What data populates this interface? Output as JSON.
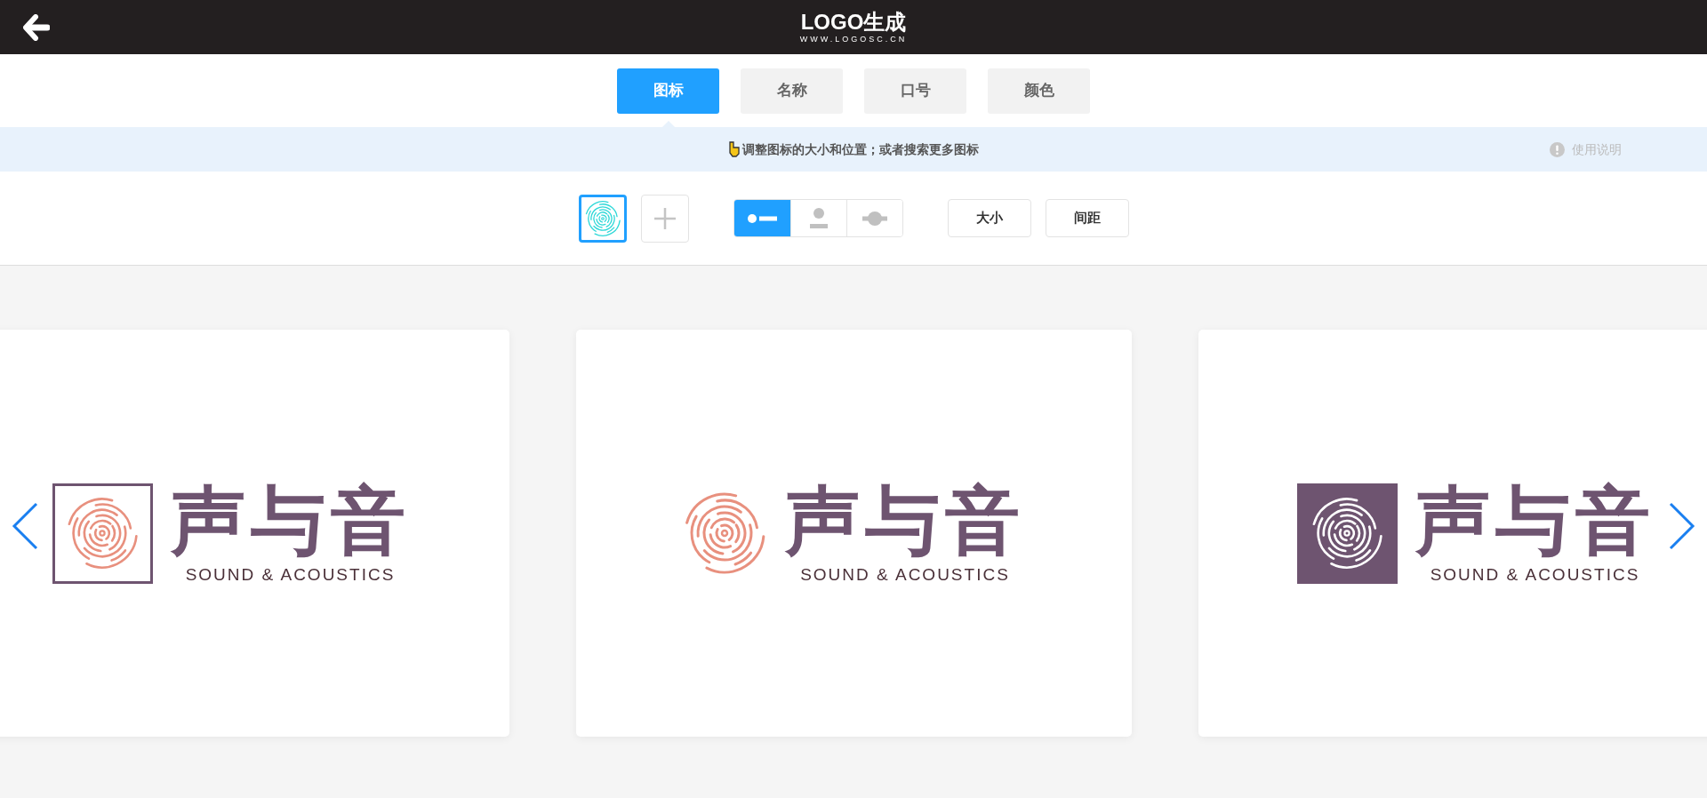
{
  "header": {
    "logo": "LOGO生成",
    "url": "WWW.LOGOSC.CN"
  },
  "tabs": [
    {
      "label": "图标",
      "selected": true
    },
    {
      "label": "名称",
      "selected": false
    },
    {
      "label": "口号",
      "selected": false
    },
    {
      "label": "颜色",
      "selected": false
    }
  ],
  "hint": {
    "text": "调整图标的大小和位置；或者搜索更多图标",
    "help": "使用说明"
  },
  "toolbar": {
    "icons": [
      {
        "kind": "icon",
        "selected": true
      },
      {
        "kind": "add",
        "selected": false
      }
    ],
    "layouts": [
      {
        "kind": "left",
        "selected": true
      },
      {
        "kind": "top",
        "selected": false
      },
      {
        "kind": "overlay",
        "selected": false
      }
    ],
    "buttons": [
      "大小",
      "间距"
    ]
  },
  "cards": [
    {
      "kind": "outline",
      "name": "声与音",
      "tagline": "SOUND & ACOUSTICS"
    },
    {
      "kind": "plain",
      "name": "声与音",
      "tagline": "SOUND & ACOUSTICS"
    },
    {
      "kind": "filled",
      "name": "声与音",
      "tagline": "SOUND & ACOUSTICS"
    }
  ]
}
